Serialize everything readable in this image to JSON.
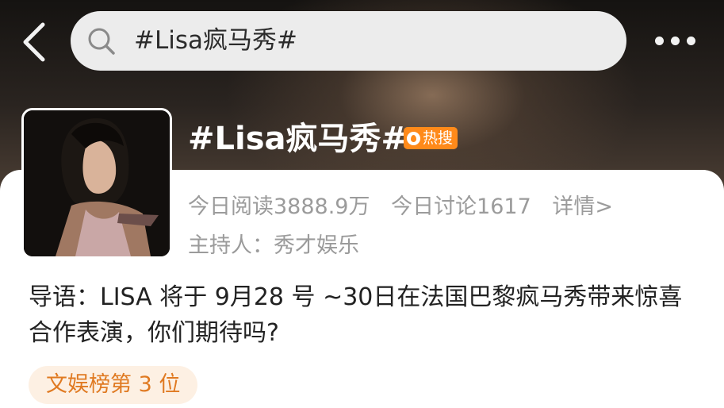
{
  "search": {
    "icon": "search-icon",
    "query": "#Lisa疯马秀#"
  },
  "nav": {
    "back_icon": "chevron-left-icon",
    "more_icon": "more-horizontal-icon"
  },
  "topic": {
    "title": "#Lisa疯马秀#",
    "hot_badge": "热搜",
    "hot_badge_color": "#ff8a1a",
    "read_today": "今日阅读3888.9万",
    "discuss_today": "今日讨论1617",
    "details_link": "详情>",
    "host": "主持人：秀才娱乐",
    "intro": "导语：LISA 将于 9月28 号 ~30日在法国巴黎疯马秀带来惊喜合作表演，你们期待吗?",
    "rank": "文娱榜第 3 位"
  }
}
